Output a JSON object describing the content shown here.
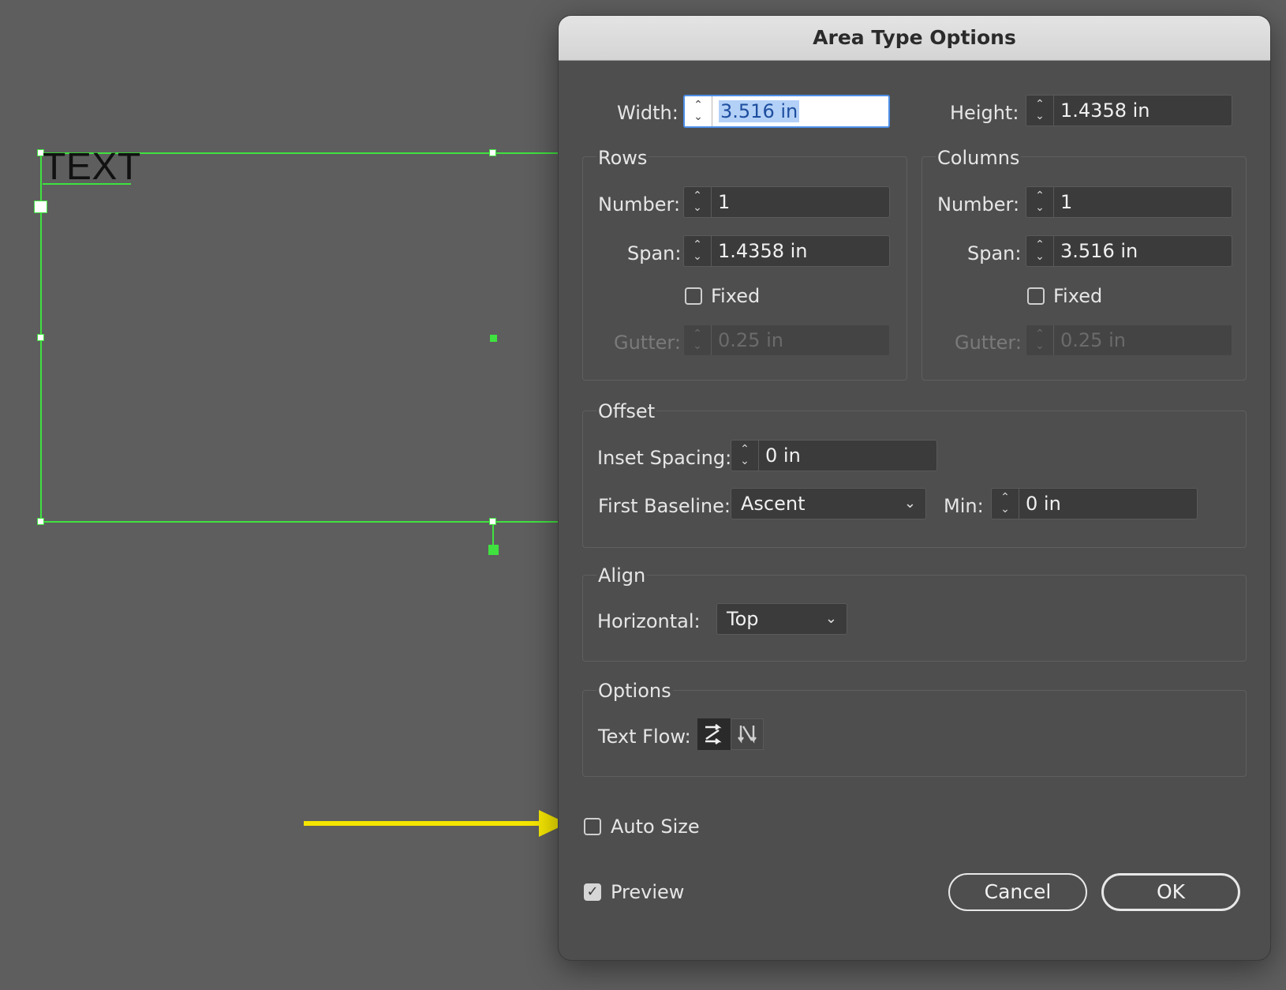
{
  "canvas": {
    "text": "TEXT"
  },
  "dialog": {
    "title": "Area Type Options",
    "width": {
      "label": "Width:",
      "value": "3.516 in"
    },
    "height": {
      "label": "Height:",
      "value": "1.4358 in"
    },
    "rows": {
      "title": "Rows",
      "number": {
        "label": "Number:",
        "value": "1"
      },
      "span": {
        "label": "Span:",
        "value": "1.4358 in"
      },
      "fixed": {
        "label": "Fixed",
        "checked": false
      },
      "gutter": {
        "label": "Gutter:",
        "value": "0.25 in",
        "disabled": true
      }
    },
    "columns": {
      "title": "Columns",
      "number": {
        "label": "Number:",
        "value": "1"
      },
      "span": {
        "label": "Span:",
        "value": "3.516 in"
      },
      "fixed": {
        "label": "Fixed",
        "checked": false
      },
      "gutter": {
        "label": "Gutter:",
        "value": "0.25 in",
        "disabled": true
      }
    },
    "offset": {
      "title": "Offset",
      "inset_spacing": {
        "label": "Inset Spacing:",
        "value": "0 in"
      },
      "first_baseline": {
        "label": "First Baseline:",
        "value": "Ascent"
      },
      "min": {
        "label": "Min:",
        "value": "0 in"
      }
    },
    "align": {
      "title": "Align",
      "horizontal": {
        "label": "Horizontal:",
        "value": "Top"
      }
    },
    "options": {
      "title": "Options",
      "text_flow": {
        "label": "Text Flow:",
        "icons": [
          "text-flow-by-rows-icon",
          "text-flow-by-columns-icon"
        ]
      }
    },
    "auto_size": {
      "label": "Auto Size",
      "checked": false
    },
    "preview": {
      "label": "Preview",
      "checked": true
    },
    "cancel_label": "Cancel",
    "ok_label": "OK"
  },
  "colors": {
    "selection_green": "#3fe23f",
    "annotation_arrow": "#f5e600"
  }
}
